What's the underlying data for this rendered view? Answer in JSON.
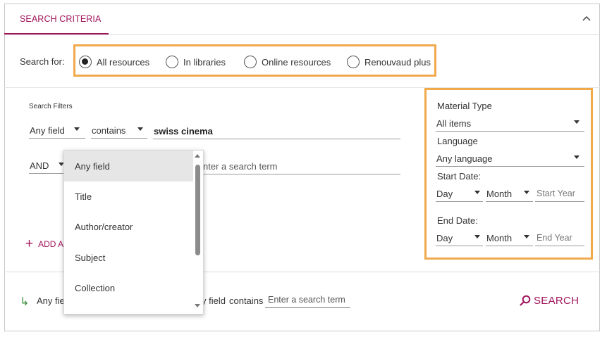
{
  "tab": {
    "label": "SEARCH CRITERIA"
  },
  "search_for": {
    "label": "Search for:",
    "options": [
      "All resources",
      "In libraries",
      "Online resources",
      "Renouvaud plus"
    ],
    "selected": "All resources"
  },
  "filters": {
    "label": "Search Filters",
    "row1": {
      "field": "Any field",
      "operator": "contains",
      "term": "swiss cinema"
    },
    "row2": {
      "boolean": "AND",
      "term_placeholder": "nter a search term"
    },
    "add_label": "ADD A"
  },
  "dropdown": {
    "items": [
      "Any field",
      "Title",
      "Author/creator",
      "Subject",
      "Collection"
    ],
    "selected": "Any field"
  },
  "right_panel": {
    "material_type_label": "Material Type",
    "material_type_value": "All items",
    "language_label": "Language",
    "language_value": "Any language",
    "start_date_label": "Start Date:",
    "end_date_label": "End Date:",
    "day": "Day",
    "month": "Month",
    "start_year_placeholder": "Start Year",
    "end_year_placeholder": "End Year"
  },
  "summary": {
    "field_partial": "Any fiel",
    "field_partial2": "y field",
    "contains": "contains",
    "input_placeholder": "Enter a search term"
  },
  "search_button": {
    "label": "SEARCH"
  },
  "colors": {
    "accent": "#a1155c",
    "highlight": "#f0a94b",
    "arrow": "#3c8f3c"
  }
}
